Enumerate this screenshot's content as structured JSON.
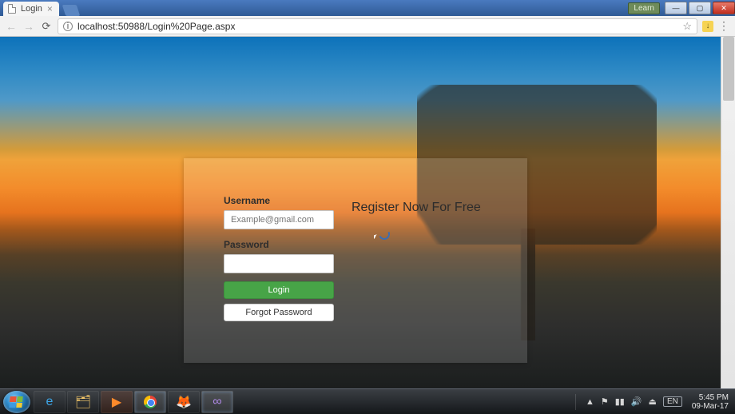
{
  "window": {
    "learn_btn": "Learn"
  },
  "browser": {
    "tab_title": "Login",
    "url": "localhost:50988/Login%20Page.aspx"
  },
  "login": {
    "username_label": "Username",
    "username_placeholder": "Example@gmail.com",
    "password_label": "Password",
    "login_button": "Login",
    "forgot_button": "Forgot Password",
    "register_heading": "Register Now For Free"
  },
  "taskbar": {
    "lang": "EN",
    "time": "5:45 PM",
    "date": "09-Mar-17"
  }
}
